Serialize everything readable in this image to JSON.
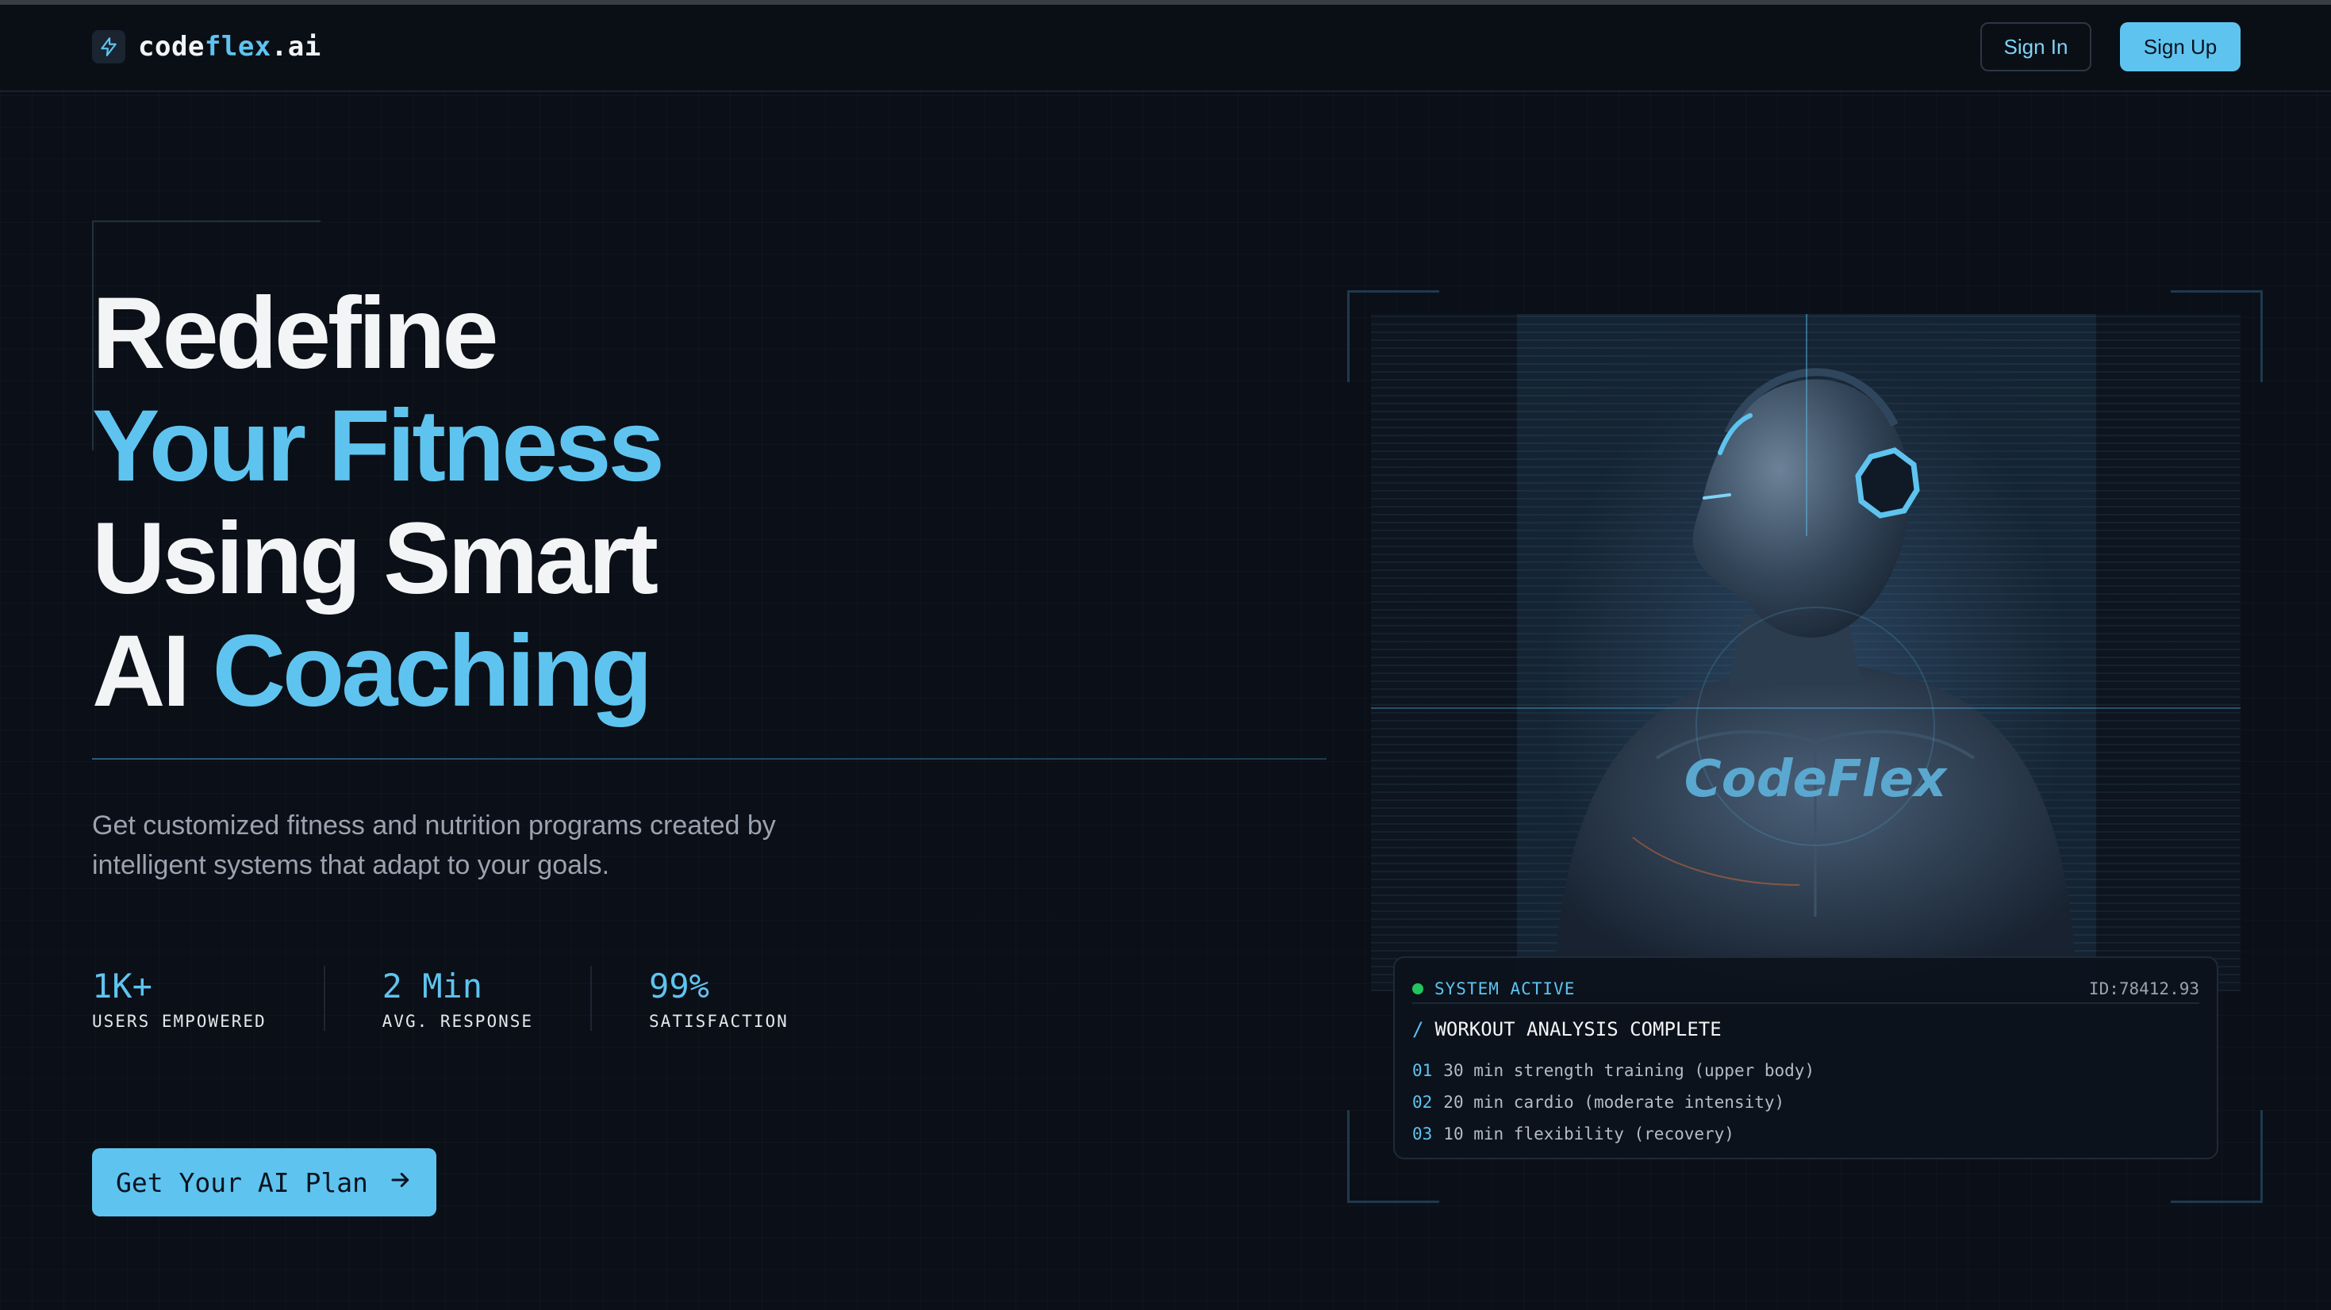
{
  "header": {
    "logo_prefix": "code",
    "logo_accent": "flex",
    "logo_suffix": ".ai",
    "sign_in": "Sign In",
    "sign_up": "Sign Up"
  },
  "hero": {
    "line1": "Redefine",
    "line2": "Your Fitness",
    "line3": "Using Smart",
    "line4_plain": "AI",
    "line4_accent": "Coaching",
    "subtitle": "Get customized fitness and nutrition programs created by intelligent systems that adapt to your goals.",
    "stats": [
      {
        "value": "1K+",
        "label": "USERS EMPOWERED"
      },
      {
        "value": "2 Min",
        "label": "AVG. RESPONSE"
      },
      {
        "value": "99%",
        "label": "SATISFACTION"
      }
    ],
    "cta_label": "Get Your AI Plan"
  },
  "visual": {
    "brand_text": "CodeFlex"
  },
  "panel": {
    "status": "SYSTEM ACTIVE",
    "id": "ID:78412.93",
    "title": "WORKOUT ANALYSIS COMPLETE",
    "items": [
      {
        "num": "01",
        "text": "30 min strength training (upper body)"
      },
      {
        "num": "02",
        "text": "20 min cardio (moderate intensity)"
      },
      {
        "num": "03",
        "text": "10 min flexibility (recovery)"
      }
    ]
  },
  "colors": {
    "accent": "#5ec4ef",
    "background": "#0b0f17",
    "status_active": "#22c55e"
  },
  "icons": {
    "logo": "lightning-icon",
    "cta": "arrow-right-icon"
  }
}
